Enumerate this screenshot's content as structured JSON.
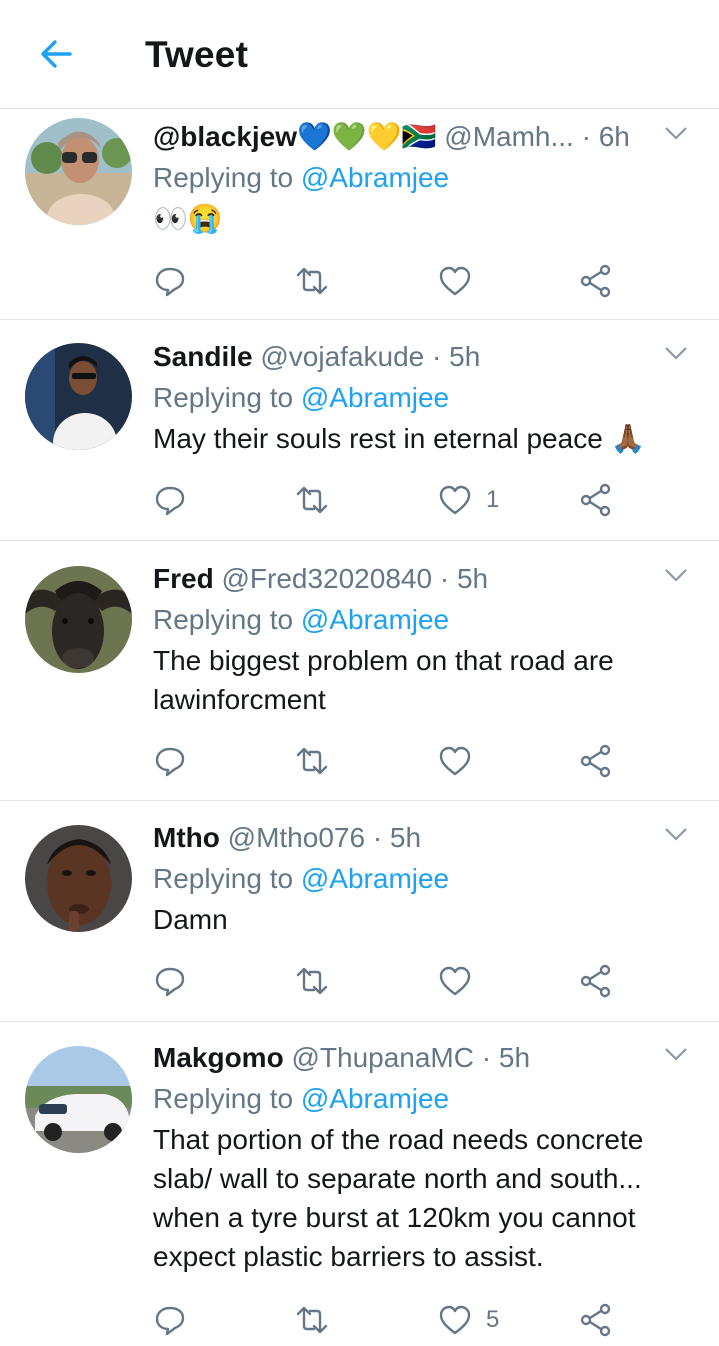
{
  "header": {
    "title": "Tweet",
    "back_icon": "arrow-left-icon",
    "accent": "#1da1f2"
  },
  "tweets": [
    {
      "name": "@blackjew💙💚💛🇿🇦",
      "handle": "@Mamh...",
      "time": "6h",
      "replying_prefix": "Replying to",
      "replying_handle": "@Abramjee",
      "text": "👀😭",
      "likes": ""
    },
    {
      "name": "Sandile",
      "handle": "@vojafakude",
      "time": "5h",
      "replying_prefix": "Replying to",
      "replying_handle": "@Abramjee",
      "text": "May their souls rest in eternal peace 🙏🏾",
      "likes": "1"
    },
    {
      "name": "Fred",
      "handle": "@Fred32020840",
      "time": "5h",
      "replying_prefix": "Replying to",
      "replying_handle": "@Abramjee",
      "text": "The biggest problem on that road are lawinforcment",
      "likes": ""
    },
    {
      "name": "Mtho",
      "handle": "@Mtho076",
      "time": "5h",
      "replying_prefix": "Replying to",
      "replying_handle": "@Abramjee",
      "text": "Damn",
      "likes": ""
    },
    {
      "name": "Makgomo",
      "handle": "@ThupanaMC",
      "time": "5h",
      "replying_prefix": "Replying to",
      "replying_handle": "@Abramjee",
      "text": "That portion of the road needs concrete slab/ wall to separate north and south... when a tyre burst at 120km you cannot expect plastic barriers to assist.",
      "likes": "5"
    }
  ],
  "colors": {
    "link": "#1da1f2",
    "secondary": "#657786",
    "text": "#14171a",
    "divider": "#dfe4e8"
  }
}
